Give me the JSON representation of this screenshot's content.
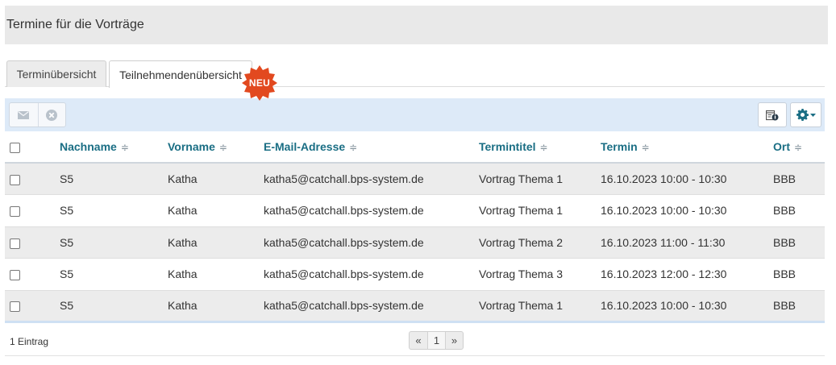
{
  "page": {
    "title": "Termine für die Vorträge"
  },
  "tabs": [
    {
      "label": "Terminübersicht",
      "active": false
    },
    {
      "label": "Teilnehmendenübersicht",
      "active": true
    }
  ],
  "badge": {
    "text": "NEU",
    "color": "#e2491f"
  },
  "toolbar": {
    "left_icons": [
      "envelope-icon",
      "cancel-circle-icon"
    ],
    "right_icons": [
      "calendar-info-icon",
      "gear-icon"
    ],
    "accent": "#1a6e84"
  },
  "table": {
    "columns": [
      "Nachname",
      "Vorname",
      "E-Mail-Adresse",
      "Termintitel",
      "Termin",
      "Ort"
    ],
    "rows": [
      [
        "S5",
        "Katha",
        "katha5@catchall.bps-system.de",
        "Vortrag Thema 1",
        "16.10.2023 10:00 - 10:30",
        "BBB"
      ],
      [
        "S5",
        "Katha",
        "katha5@catchall.bps-system.de",
        "Vortrag Thema 1",
        "16.10.2023 10:00 - 10:30",
        "BBB"
      ],
      [
        "S5",
        "Katha",
        "katha5@catchall.bps-system.de",
        "Vortrag Thema 2",
        "16.10.2023 11:00 - 11:30",
        "BBB"
      ],
      [
        "S5",
        "Katha",
        "katha5@catchall.bps-system.de",
        "Vortrag Thema 3",
        "16.10.2023 12:00 - 12:30",
        "BBB"
      ],
      [
        "S5",
        "Katha",
        "katha5@catchall.bps-system.de",
        "Vortrag Thema 1",
        "16.10.2023 10:00 - 10:30",
        "BBB"
      ]
    ]
  },
  "footer": {
    "count": "1 Eintrag",
    "pager": {
      "prev": "«",
      "current": "1",
      "next": "»"
    }
  }
}
